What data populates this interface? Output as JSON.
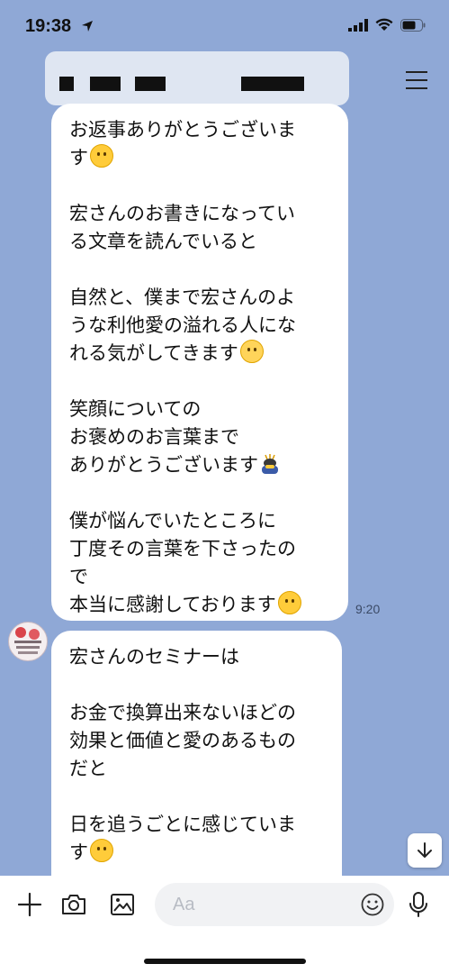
{
  "status_bar": {
    "time": "19:38",
    "icons": [
      "location-arrow-icon",
      "signal-icon",
      "wifi-icon",
      "battery-icon"
    ]
  },
  "header": {
    "menu_icon": "menu-icon"
  },
  "messages": [
    {
      "lines": [
        "お返事ありがとうございま",
        "す",
        "",
        "宏さんのお書きになってい",
        "る文章を読んでいると",
        "",
        "自然と、僕まで宏さんのよ",
        "うな利他愛の溢れる人にな",
        "れる気がしてきます",
        "",
        "笑顔についての",
        "お褒めのお言葉まで",
        "ありがとうございます",
        "",
        "僕が悩んでいたところに",
        "丁度その言葉を下さったの",
        "で",
        "本当に感謝しております"
      ],
      "time": "9:20"
    },
    {
      "lines": [
        "宏さんのセミナーは",
        "",
        "お金で換算出来ないほどの",
        "効果と価値と愛のあるもの",
        "だと",
        "",
        "日を追うごとに感じていま",
        "す"
      ]
    }
  ],
  "input": {
    "placeholder": "Aa"
  },
  "colors": {
    "background": "#8fa8d6",
    "bubble": "#ffffff",
    "emoji": "#ffcc3a"
  }
}
